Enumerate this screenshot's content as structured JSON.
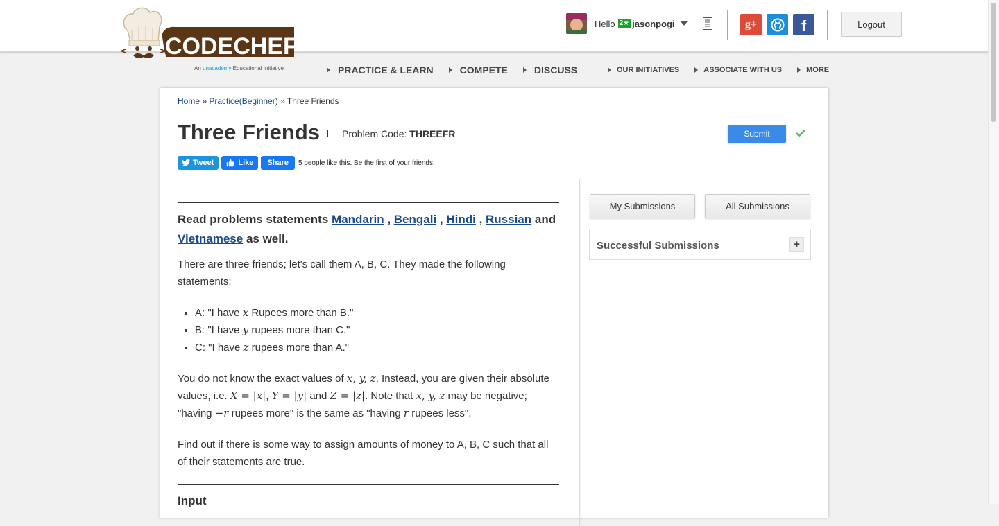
{
  "brand": {
    "logo_text": "CODECHEF",
    "tagline_prefix": "An",
    "tagline_brand": "unacademy",
    "tagline_suffix": "Educational Initiative"
  },
  "user": {
    "greeting": "Hello",
    "star_badge": "2★",
    "username": "jasonpogi"
  },
  "header": {
    "logout_label": "Logout",
    "social_icons": [
      "google-plus-icon",
      "github-icon",
      "facebook-icon"
    ]
  },
  "nav": {
    "main": [
      "PRACTICE & LEARN",
      "COMPETE",
      "DISCUSS"
    ],
    "secondary": [
      "OUR INITIATIVES",
      "ASSOCIATE WITH US",
      "MORE"
    ]
  },
  "breadcrumb": {
    "home": "Home",
    "sep1": " » ",
    "practice": "Practice(Beginner)",
    "sep2": " » ",
    "current": "Three Friends"
  },
  "problem": {
    "title": "Three Friends",
    "code_label": "Problem Code:",
    "code": "THREEFR",
    "submit_label": "Submit",
    "lang_intro": "Read problems statements",
    "languages": [
      "Mandarin",
      "Bengali",
      "Hindi",
      "Russian",
      "Vietnamese"
    ],
    "lang_and": "and",
    "lang_outro": "as well.",
    "intro": "There are three friends; let's call them A, B, C. They made the following statements:",
    "statements": [
      {
        "pre": "A: \"I have ",
        "var": "x",
        "post": " Rupees more than B.\""
      },
      {
        "pre": "B: \"I have ",
        "var": "y",
        "post": " rupees more than C.\""
      },
      {
        "pre": "C: \"I have ",
        "var": "z",
        "post": " rupees more than A.\""
      }
    ],
    "para2_a": "You do not know the exact values of ",
    "para2_vars": "x, y, z",
    "para2_b": ". Instead, you are given their absolute values, i.e. ",
    "para2_m1": "X = |x|",
    "para2_m2": "Y = |y|",
    "para2_and": " and ",
    "para2_m3": "Z = |z|",
    "para2_c": ". Note that ",
    "para2_d": " may be negative; \"having ",
    "para2_m4": "−r",
    "para2_e": " rupees more\" is the same as \"having ",
    "para2_m5": "r",
    "para2_f": " rupees less\".",
    "para3": "Find out if there is some way to assign amounts of money to A, B, C such that all of their statements are true.",
    "input_heading": "Input"
  },
  "share": {
    "tweet_label": "Tweet",
    "like_label": "Like",
    "share_label": "Share",
    "like_text": "5 people like this. Be the first of your friends."
  },
  "sidebar": {
    "my_submissions": "My Submissions",
    "all_submissions": "All Submissions",
    "successful_submissions": "Successful Submissions",
    "expand_symbol": "+"
  }
}
